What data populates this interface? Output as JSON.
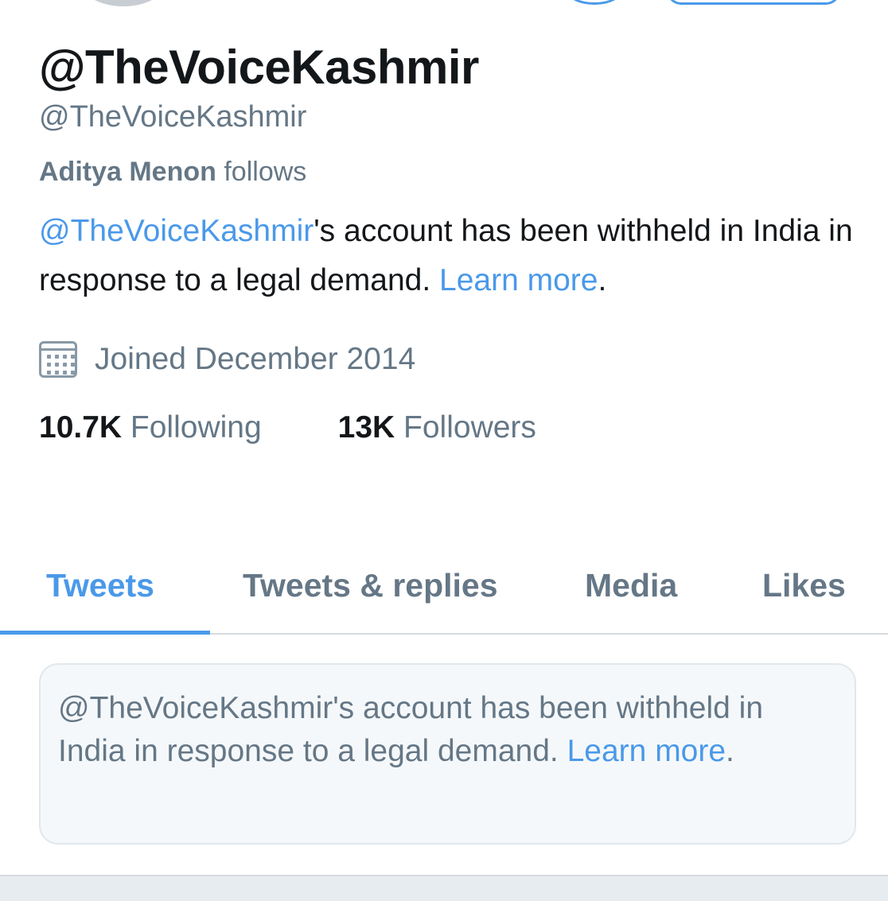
{
  "profile": {
    "display_name": "@TheVoiceKashmir",
    "handle": "@TheVoiceKashmir",
    "follows_name": "Aditya Menon",
    "follows_suffix": " follows",
    "bio": {
      "mention": "@TheVoiceKashmir",
      "text": "'s account has been withheld in India in response to a legal demand. ",
      "learn_more": "Learn more",
      "period": "."
    },
    "joined": "Joined December 2014",
    "calendar_icon": "calendar-icon",
    "following_count": "10.7K",
    "following_label": " Following",
    "followers_count": "13K",
    "followers_label": " Followers"
  },
  "tabs": [
    {
      "label": "Tweets",
      "active": true
    },
    {
      "label": "Tweets & replies",
      "active": false
    },
    {
      "label": "Media",
      "active": false
    },
    {
      "label": "Likes",
      "active": false
    }
  ],
  "notice": {
    "text": "@TheVoiceKashmir's account has been withheld in India in response to a legal demand. ",
    "learn_more": "Learn more",
    "period": "."
  },
  "colors": {
    "accent": "#4a99e9",
    "text": "#14171a",
    "secondary": "#657786",
    "notice_bg": "#f5f8fa"
  }
}
